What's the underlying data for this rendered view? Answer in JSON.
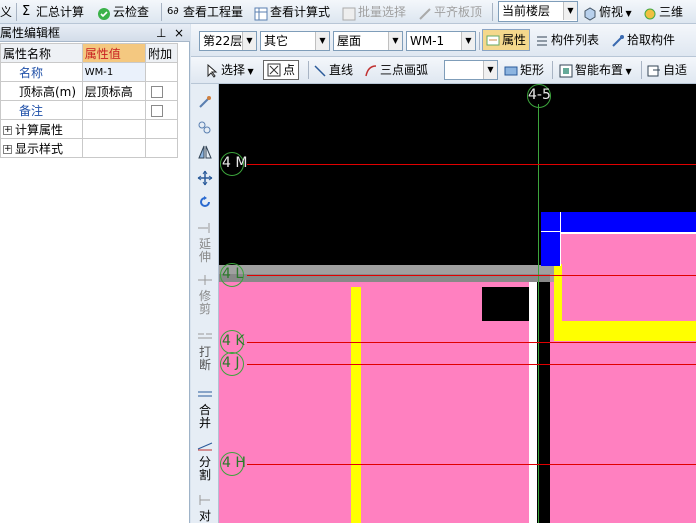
{
  "toolbar1": {
    "item_cut": "义",
    "summary": "汇总计算",
    "cloud_check": "云检查",
    "view_qty": "查看工程量",
    "view_formula": "查看计算式",
    "batch_select": "批量选择",
    "flush_slab": "平齐板顶",
    "floor_select": "当前楼层",
    "top_view": "俯视",
    "three_d": "三维"
  },
  "toolbar2": {
    "floor": "第22层",
    "category": "其它",
    "sub_category": "屋面",
    "component": "WM-1",
    "properties": "属性",
    "component_list": "构件列表",
    "pick_component": "拾取构件"
  },
  "toolbar3": {
    "select": "选择",
    "point": "点",
    "line": "直线",
    "arc": "三点画弧",
    "rect": "矩形",
    "smart_layout": "智能布置",
    "auto": "自适"
  },
  "panel": {
    "title": "属性编辑框",
    "pin": "ᵖ",
    "close": "×",
    "headers": [
      "属性名称",
      "属性值",
      "附加"
    ],
    "rows": [
      {
        "name": "名称",
        "value": "WM-1"
      },
      {
        "name": "顶标高(m)",
        "value": "层顶标高"
      },
      {
        "name": "备注",
        "value": ""
      },
      {
        "name": "计算属性",
        "value": ""
      },
      {
        "name": "显示样式",
        "value": ""
      }
    ]
  },
  "vtools": {
    "extend": "延伸",
    "trim": "修剪",
    "break": "打断",
    "merge": "合并",
    "split": "分割",
    "align": "对"
  },
  "canvas": {
    "axis_top": "4-5",
    "axis_m": "4 M",
    "axis_l": "4 L",
    "axis_k": "4 K",
    "axis_j": "4 J",
    "axis_h": "4 H"
  },
  "colors": {
    "pink": "#ff80c0",
    "yellow": "#ffff00",
    "blue": "#0000ff",
    "gray": "#a0a0a0",
    "red_line": "#e00000",
    "green_axis": "#3ca43c"
  }
}
